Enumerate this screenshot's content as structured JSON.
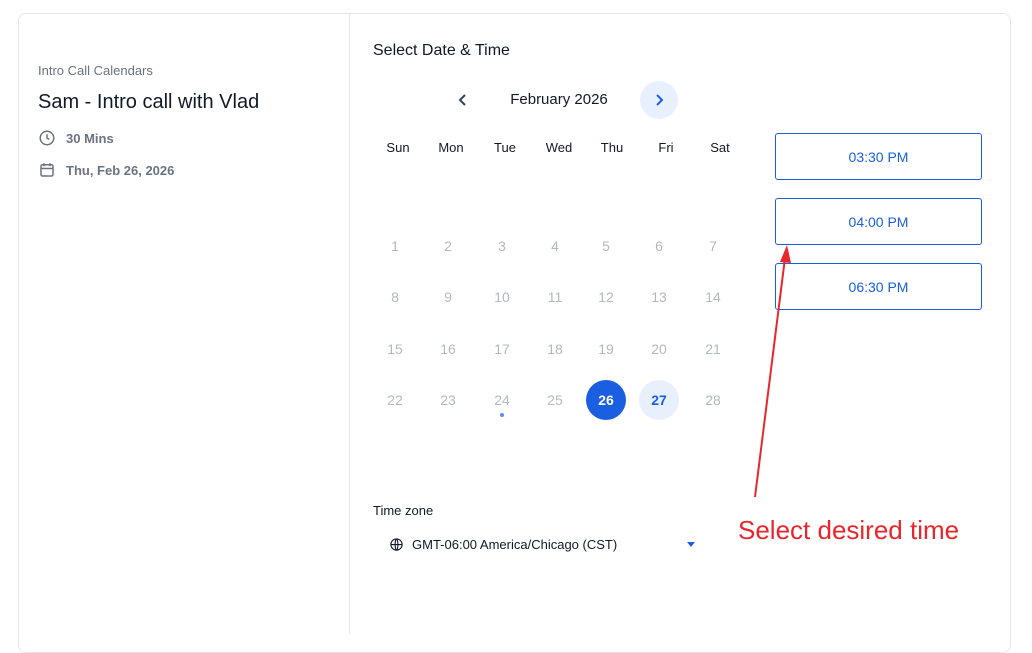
{
  "left_panel": {
    "calendar_name": "Intro Call Calendars",
    "event_title": "Sam - Intro call with Vlad",
    "duration": "30 Mins",
    "date": "Thu, Feb 26, 2026",
    "icons": [
      "clock-icon",
      "calendar-icon"
    ]
  },
  "picker": {
    "title": "Select Date & Time",
    "month": "February 2026",
    "weekdays": [
      "Sun",
      "Mon",
      "Tue",
      "Wed",
      "Thu",
      "Fri",
      "Sat"
    ],
    "days": [
      "1",
      "2",
      "3",
      "4",
      "5",
      "6",
      "7",
      "8",
      "9",
      "10",
      "11",
      "12",
      "13",
      "14",
      "15",
      "16",
      "17",
      "18",
      "19",
      "20",
      "21",
      "22",
      "23",
      "24",
      "25",
      "26",
      "27",
      "28"
    ],
    "selected_day": "26",
    "available_day": "27",
    "today_marker_day": "24",
    "accent_color": "#1a5fe0"
  },
  "slots": [
    "03:30 PM",
    "04:00 PM",
    "06:30 PM"
  ],
  "timezone": {
    "label": "Time zone",
    "value": "GMT-06:00 America/Chicago (CST)"
  },
  "annotation": {
    "text": "Select desired time",
    "color": "#e8262b"
  }
}
